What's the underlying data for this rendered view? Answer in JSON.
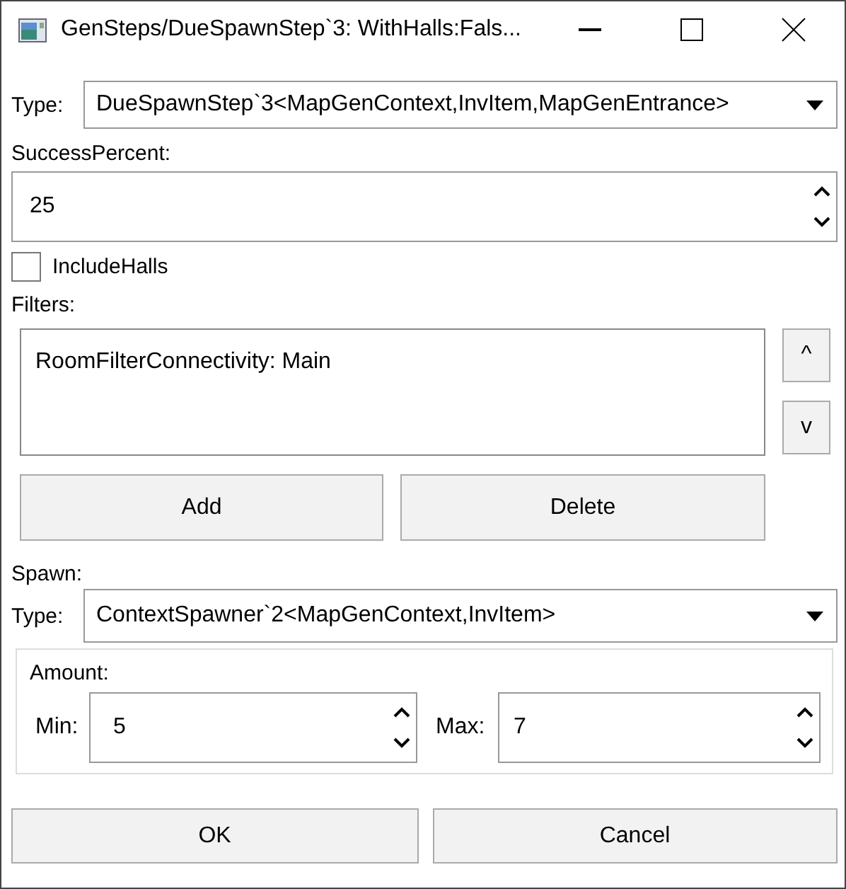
{
  "window": {
    "title": "GenSteps/DueSpawnStep`3: WithHalls:Fals..."
  },
  "type": {
    "label": "Type:",
    "value": "DueSpawnStep`3<MapGenContext,InvItem,MapGenEntrance>"
  },
  "success_percent": {
    "label": "SuccessPercent:",
    "value": "25"
  },
  "include_halls": {
    "label": "IncludeHalls",
    "checked": false
  },
  "filters": {
    "label": "Filters:",
    "items": [
      {
        "text": "RoomFilterConnectivity: Main"
      }
    ],
    "move_up": "^",
    "move_down": "v",
    "add": "Add",
    "delete": "Delete"
  },
  "spawn": {
    "label": "Spawn:",
    "type_label": "Type:",
    "type_value": "ContextSpawner`2<MapGenContext,InvItem>",
    "amount": {
      "label": "Amount:",
      "min_label": "Min:",
      "min": "5",
      "max_label": "Max:",
      "max": "7"
    }
  },
  "buttons": [
    "OK",
    "Cancel"
  ]
}
